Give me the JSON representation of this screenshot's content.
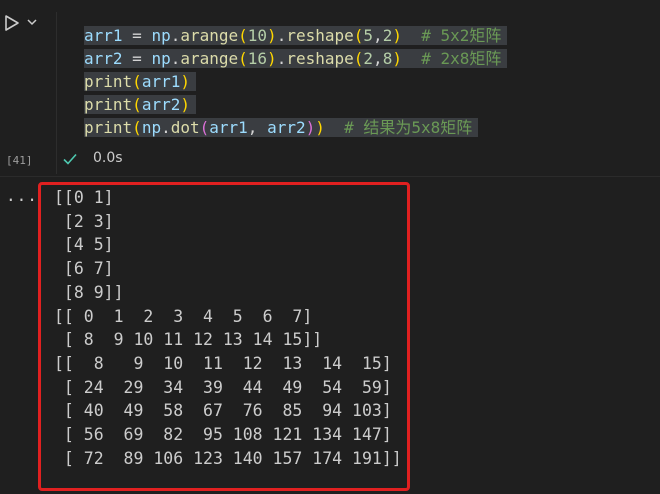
{
  "cell": {
    "code_lines": [
      [
        {
          "t": "arr1",
          "c": "v"
        },
        {
          "t": " = ",
          "c": "o"
        },
        {
          "t": "np",
          "c": "v"
        },
        {
          "t": ".",
          "c": "o"
        },
        {
          "t": "arange",
          "c": "f"
        },
        {
          "t": "(",
          "c": "p"
        },
        {
          "t": "10",
          "c": "n"
        },
        {
          "t": ")",
          "c": "p"
        },
        {
          "t": ".",
          "c": "o"
        },
        {
          "t": "reshape",
          "c": "f"
        },
        {
          "t": "(",
          "c": "p"
        },
        {
          "t": "5",
          "c": "n"
        },
        {
          "t": ",",
          "c": "o"
        },
        {
          "t": "2",
          "c": "n"
        },
        {
          "t": ")",
          "c": "p"
        },
        {
          "t": "  # 5x2矩阵",
          "c": "c"
        }
      ],
      [
        {
          "t": "arr2",
          "c": "v"
        },
        {
          "t": " = ",
          "c": "o"
        },
        {
          "t": "np",
          "c": "v"
        },
        {
          "t": ".",
          "c": "o"
        },
        {
          "t": "arange",
          "c": "f"
        },
        {
          "t": "(",
          "c": "p"
        },
        {
          "t": "16",
          "c": "n"
        },
        {
          "t": ")",
          "c": "p"
        },
        {
          "t": ".",
          "c": "o"
        },
        {
          "t": "reshape",
          "c": "f"
        },
        {
          "t": "(",
          "c": "p"
        },
        {
          "t": "2",
          "c": "n"
        },
        {
          "t": ",",
          "c": "o"
        },
        {
          "t": "8",
          "c": "n"
        },
        {
          "t": ")",
          "c": "p"
        },
        {
          "t": "  # 2x8矩阵",
          "c": "c"
        }
      ],
      [
        {
          "t": "print",
          "c": "f"
        },
        {
          "t": "(",
          "c": "p"
        },
        {
          "t": "arr1",
          "c": "v"
        },
        {
          "t": ")",
          "c": "p"
        }
      ],
      [
        {
          "t": "print",
          "c": "f"
        },
        {
          "t": "(",
          "c": "p"
        },
        {
          "t": "arr2",
          "c": "v"
        },
        {
          "t": ")",
          "c": "p"
        }
      ],
      [
        {
          "t": "print",
          "c": "f"
        },
        {
          "t": "(",
          "c": "p"
        },
        {
          "t": "np",
          "c": "v"
        },
        {
          "t": ".",
          "c": "o"
        },
        {
          "t": "dot",
          "c": "f"
        },
        {
          "t": "(",
          "c": "m"
        },
        {
          "t": "arr1",
          "c": "v"
        },
        {
          "t": ", ",
          "c": "o"
        },
        {
          "t": "arr2",
          "c": "v"
        },
        {
          "t": ")",
          "c": "m"
        },
        {
          "t": ")",
          "c": "p"
        },
        {
          "t": "  # 结果为5x8矩阵",
          "c": "c"
        }
      ]
    ],
    "execution_count": "[41]",
    "status": "success",
    "duration": "0.0s"
  },
  "output": {
    "more_label": "...",
    "lines": [
      "[[0 1]",
      " [2 3]",
      " [4 5]",
      " [6 7]",
      " [8 9]]",
      "[[ 0  1  2  3  4  5  6  7]",
      " [ 8  9 10 11 12 13 14 15]]",
      "[[  8   9  10  11  12  13  14  15]",
      " [ 24  29  34  39  44  49  54  59]",
      " [ 40  49  58  67  76  85  94 103]",
      " [ 56  69  82  95 108 121 134 147]",
      " [ 72  89 106 123 140 157 174 191]]"
    ]
  },
  "colors": {
    "highlight_border": "#e02020",
    "success": "#4ec9b0"
  },
  "icons": {
    "run": "play-icon",
    "chevron": "chevron-down-icon",
    "status": "check-icon",
    "more": "more-icon"
  }
}
